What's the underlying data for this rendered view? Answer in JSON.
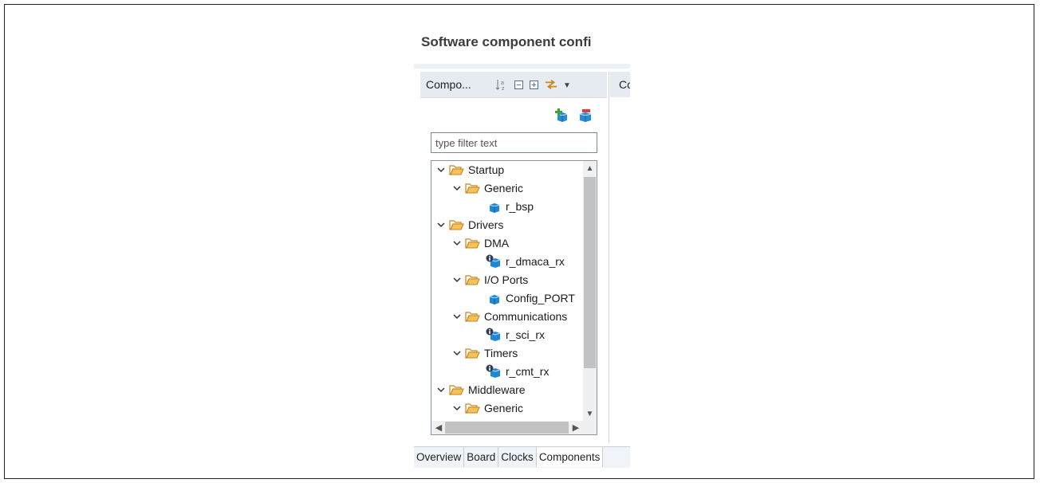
{
  "page": {
    "title": "Software component confi"
  },
  "panel": {
    "title": "Compo...",
    "right_header": "Co",
    "filter_placeholder": "type filter text",
    "toolbar": {
      "sort_icon": "sort-alpha-icon",
      "collapse_icon": "collapse-all-icon",
      "expand_icon": "expand-all-icon",
      "sync_icon": "sync-icon",
      "menu_icon": "view-menu-icon",
      "add_icon": "add-component-icon",
      "remove_icon": "remove-component-icon"
    }
  },
  "tree": {
    "items": [
      {
        "label": "Startup",
        "kind": "folder",
        "level": 0
      },
      {
        "label": "Generic",
        "kind": "folder",
        "level": 1
      },
      {
        "label": "r_bsp",
        "kind": "component",
        "level": 2
      },
      {
        "label": "Drivers",
        "kind": "folder",
        "level": 0
      },
      {
        "label": "DMA",
        "kind": "folder",
        "level": 1
      },
      {
        "label": "r_dmaca_rx",
        "kind": "component-info",
        "level": 2
      },
      {
        "label": "I/O Ports",
        "kind": "folder",
        "level": 1
      },
      {
        "label": "Config_PORT",
        "kind": "component",
        "level": 2
      },
      {
        "label": "Communications",
        "kind": "folder",
        "level": 1
      },
      {
        "label": "r_sci_rx",
        "kind": "component-info",
        "level": 2
      },
      {
        "label": "Timers",
        "kind": "folder",
        "level": 1
      },
      {
        "label": "r_cmt_rx",
        "kind": "component-info",
        "level": 2
      },
      {
        "label": "Middleware",
        "kind": "folder",
        "level": 0
      },
      {
        "label": "Generic",
        "kind": "folder",
        "level": 1
      }
    ]
  },
  "tabs": [
    {
      "label": "Overview",
      "active": false
    },
    {
      "label": "Board",
      "active": false
    },
    {
      "label": "Clocks",
      "active": false
    },
    {
      "label": "Components",
      "active": true
    }
  ],
  "colors": {
    "header_bg": "#e6ebf2",
    "folder": "#e8a23a",
    "component": "#1e88d6",
    "info_badge": "#2f3e55"
  }
}
